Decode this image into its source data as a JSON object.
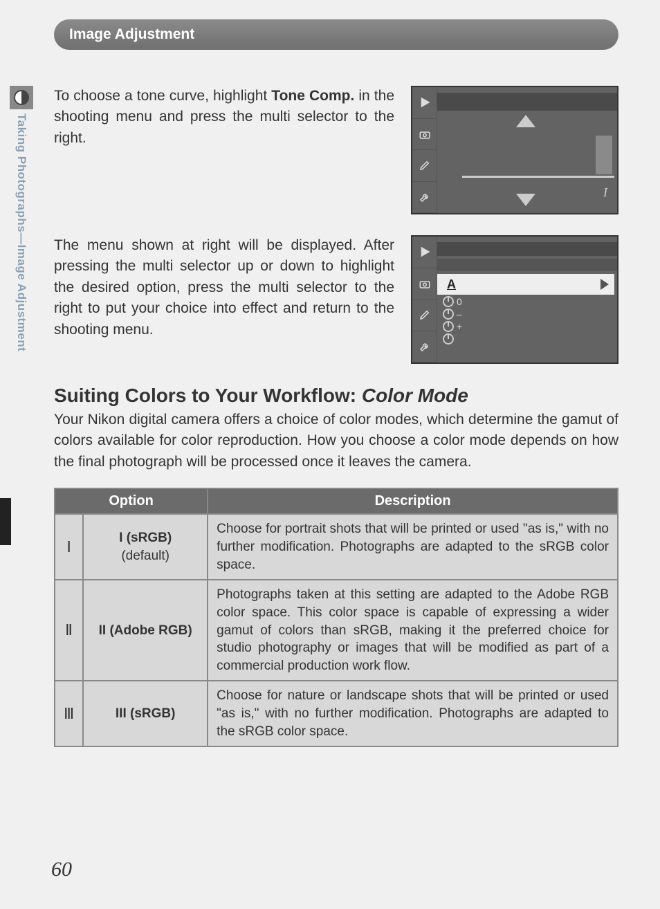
{
  "header": {
    "title": "Image Adjustment"
  },
  "sidebar": {
    "label": "Taking Photographs—Image Adjustment"
  },
  "para1": {
    "pre": "To choose a tone curve, highlight ",
    "bold": "Tone Comp.",
    "post": " in the shooting menu and press the multi selector to the right."
  },
  "para2": "The menu shown at right will be displayed.  After pressing the multi selector up or down to highlight the desired option, press the multi selector to the right to put your choice into effect and return to the shooting menu.",
  "screenshot1": {
    "marker": "I"
  },
  "screenshot2": {
    "selected_letter": "A",
    "opts": [
      "0",
      "–",
      "+",
      ""
    ]
  },
  "section": {
    "title_plain": "Suiting Colors to Your Workflow: ",
    "title_italic": "Color Mode",
    "body": "Your Nikon digital camera offers a choice of color modes, which determine the gamut of colors available for color reproduction.  How you choose a color mode depends on how the final photograph will be processed once it leaves the camera."
  },
  "table": {
    "headers": {
      "option": "Option",
      "description": "Description"
    },
    "rows": [
      {
        "icon": "Ⅰ",
        "option_main": "I (sRGB)",
        "option_sub": "(default)",
        "desc": "Choose for portrait shots that will be printed or used \"as is,\" with no further modification.  Photographs are adapted to the sRGB color space."
      },
      {
        "icon": "Ⅱ",
        "option_main": "II (Adobe RGB)",
        "option_sub": "",
        "desc": "Photographs taken at this setting are adapted to the Adobe RGB color space.  This color space is capable of expressing a wider gamut of colors than sRGB, making it the preferred choice for studio photography or images that will be modified as part of a commercial production work flow."
      },
      {
        "icon": "Ⅲ",
        "option_main": "III (sRGB)",
        "option_sub": "",
        "desc": "Choose for nature or landscape shots that will be printed or used \"as is,\" with no further modification.  Photographs are adapted to the sRGB color space."
      }
    ]
  },
  "page_number": "60"
}
